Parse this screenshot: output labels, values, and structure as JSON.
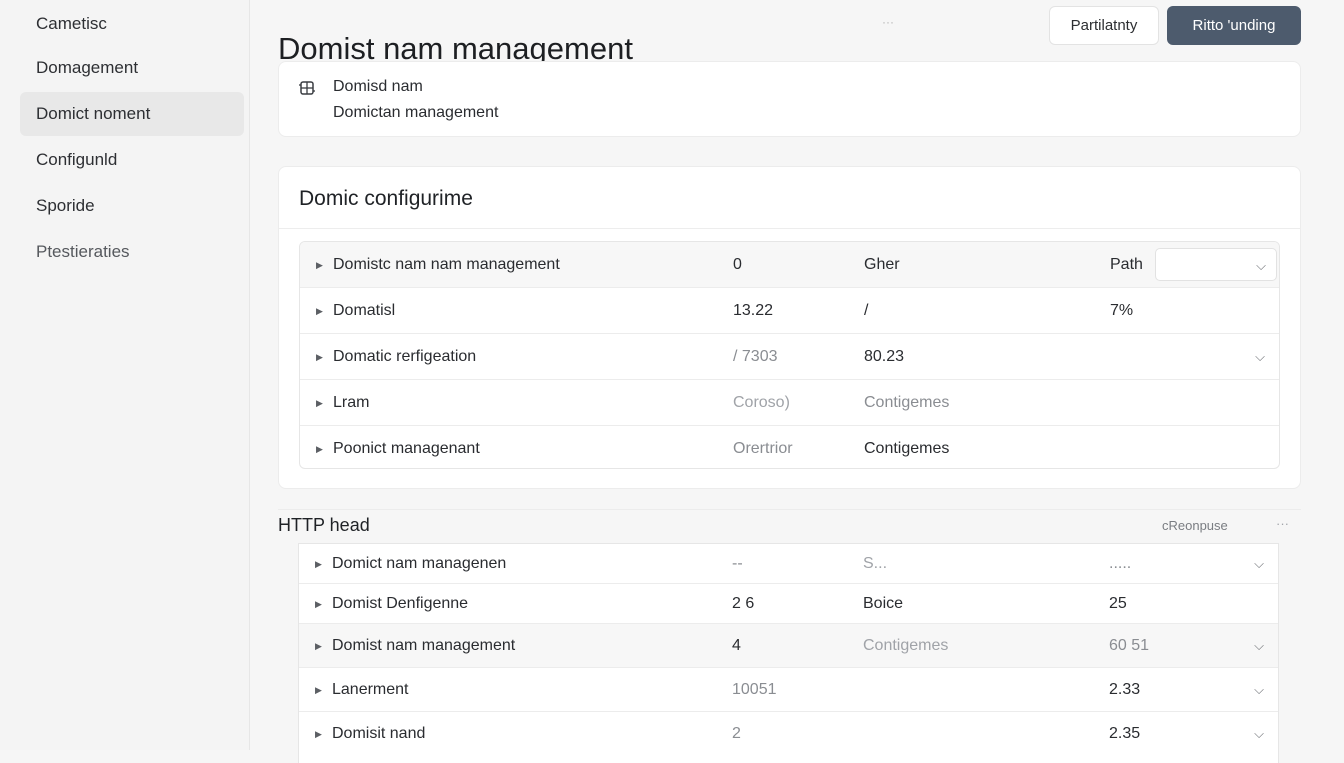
{
  "sidebar": {
    "items": [
      {
        "label": "Cametisc"
      },
      {
        "label": "Domagement"
      },
      {
        "label": "Domict noment"
      },
      {
        "label": "Configunld"
      },
      {
        "label": "Sporide"
      },
      {
        "label": "Ptestieraties"
      }
    ]
  },
  "header": {
    "title": "Domist nam management",
    "dots": "···",
    "secondary_button": "Partilatnty",
    "primary_button": "Ritto 'unding"
  },
  "info_card": {
    "line1": "Domisd nam",
    "line2": "Domictan management"
  },
  "config": {
    "title": "Domic configurime",
    "rows": [
      {
        "name": "Domistc nam nam management",
        "v1": "0",
        "v2": "Gher",
        "v3": "Path"
      },
      {
        "name": "Domatisl",
        "v1": "13.22",
        "v2": "/",
        "v3": "7%"
      },
      {
        "name": "Domatic rerfigeation",
        "v1": "/ 7303",
        "v2": "80.23",
        "v3": ""
      },
      {
        "name": "Lram",
        "v1": "Coroso)",
        "v2": "Contigemes",
        "v3": ""
      },
      {
        "name": "Poonict managenant",
        "v1": "Orertrior",
        "v2": "Contigemes",
        "v3": ""
      }
    ]
  },
  "http": {
    "title": "HTTP head",
    "action": "cReonpuse",
    "more": "···",
    "rows": [
      {
        "name": "Domict nam managenen",
        "v1": "--",
        "v2": "S...",
        "v3": "....."
      },
      {
        "name": "Domist Denfigenne",
        "v1": "2 6",
        "v2": "Boice",
        "v3": "25"
      },
      {
        "name": "Domist nam management",
        "v1": "4",
        "v2": "Contigemes",
        "v3": "60 51"
      },
      {
        "name": "Lanerment",
        "v1": "10051",
        "v2": "",
        "v3": "2.33"
      },
      {
        "name": "Domisit nand",
        "v1": "2",
        "v2": "",
        "v3": "2.35"
      }
    ]
  },
  "icons": {
    "caret": "caret-right-icon",
    "chevron": "chevron-down-icon",
    "info": "domain-icon"
  },
  "colors": {
    "primary_button": "#4d5b6d",
    "active_nav": "#e8e8e8"
  }
}
